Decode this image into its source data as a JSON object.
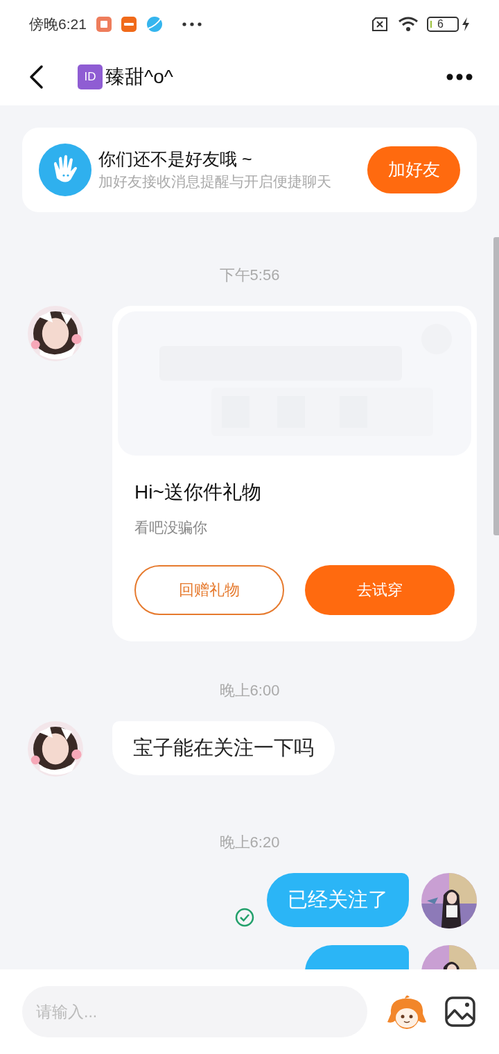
{
  "status_bar": {
    "time": "傍晚6:21",
    "battery": "6"
  },
  "header": {
    "badge": "ID",
    "title": "臻甜^o^"
  },
  "friend_banner": {
    "title": "你们还不是好友哦 ~",
    "subtitle": "加好友接收消息提醒与开启便捷聊天",
    "button": "加好友"
  },
  "messages": [
    {
      "kind": "time",
      "text": "下午5:56"
    },
    {
      "kind": "gift_card",
      "title": "Hi~送你件礼物",
      "subtitle": "看吧没骗你",
      "buttons": [
        {
          "label": "回赠礼物",
          "primary": false
        },
        {
          "label": "去试穿",
          "primary": true
        }
      ]
    },
    {
      "kind": "time",
      "text": "晚上6:00"
    },
    {
      "kind": "incoming_text",
      "text": "宝子能在关注一下吗",
      "delivered": false
    },
    {
      "kind": "time",
      "text": "晚上6:20"
    },
    {
      "kind": "outgoing_text",
      "text": "已经关注了",
      "delivered": true
    },
    {
      "kind": "outgoing_text"
    }
  ],
  "input": {
    "placeholder": "请输入..."
  }
}
